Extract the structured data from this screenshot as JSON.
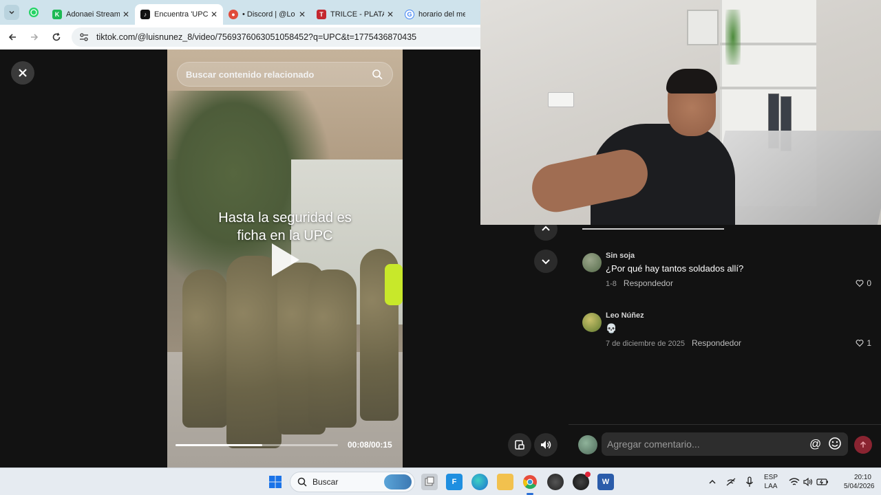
{
  "browser": {
    "tabs": [
      {
        "title": "Adonaei Stream",
        "favicon_color": "#1db954",
        "favicon_letter": "K"
      },
      {
        "title": "Encuentra 'UPC",
        "favicon_color": "#111111",
        "favicon_letter": "♪",
        "active": true
      },
      {
        "title": "• Discord | @Lo",
        "favicon_color": "#e04b3a",
        "favicon_letter": "●"
      },
      {
        "title": "TRILCE - PLATAF",
        "favicon_color": "#c4282f",
        "favicon_letter": "T"
      },
      {
        "title": "horario del met",
        "favicon_color": "#4285f4",
        "favicon_letter": "G"
      }
    ],
    "url": "tiktok.com/@luisnunez_8/video/7569376063051058452?q=UPC&t=1775436870435"
  },
  "video": {
    "search_placeholder": "Buscar contenido relacionado",
    "caption_line1": "Hasta la seguridad es",
    "caption_line2": "ficha en la UPC",
    "progress": 0.533,
    "time": "00:08/00:15"
  },
  "comments": [
    {
      "user": "Sin soja",
      "text": "¿Por qué hay tantos soldados allí?",
      "date": "1-8",
      "reply_label": "Respondedor",
      "likes": "0",
      "avatar_color": "#556b4a"
    },
    {
      "user": "Leo Núñez",
      "text": "💀",
      "date": "7 de diciembre de 2025",
      "reply_label": "Respondedor",
      "likes": "1",
      "avatar_color": "#7c8f3c"
    }
  ],
  "composer": {
    "placeholder": "Agregar comentario...",
    "at_symbol": "@"
  },
  "taskbar": {
    "search_label": "Buscar",
    "lang_line1": "ESP",
    "lang_line2": "LAA",
    "time": "20:10",
    "date": "5/04/2026"
  },
  "colors": {
    "tabbar_bg": "#cfe3ec",
    "send_button": "#8a2431",
    "page_bg": "#121212"
  }
}
